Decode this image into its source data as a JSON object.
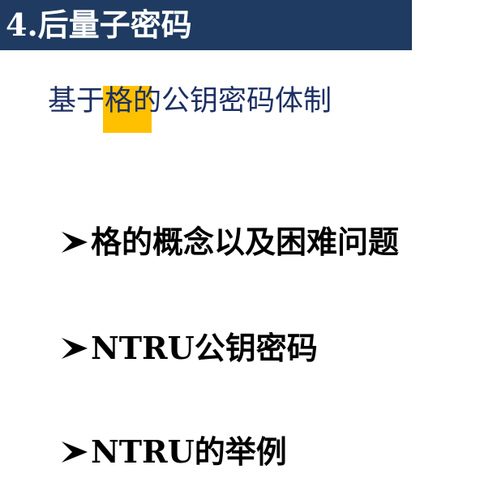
{
  "header": {
    "title": "4.后量子密码"
  },
  "subtitle": {
    "prefix": "基于",
    "highlight": "格",
    "suffix": "的公钥密码体制"
  },
  "bullets": [
    {
      "text": "格的概念以及困难问题"
    },
    {
      "text": "NTRU公钥密码"
    },
    {
      "text": "NTRU的举例"
    }
  ],
  "colors": {
    "title_bar": "#1f3b61",
    "subtitle_text": "#1d2f63",
    "highlight": "#ffc000",
    "bullet_text": "#000000"
  },
  "icons": {
    "bullet": "arrow-bullet-icon"
  }
}
